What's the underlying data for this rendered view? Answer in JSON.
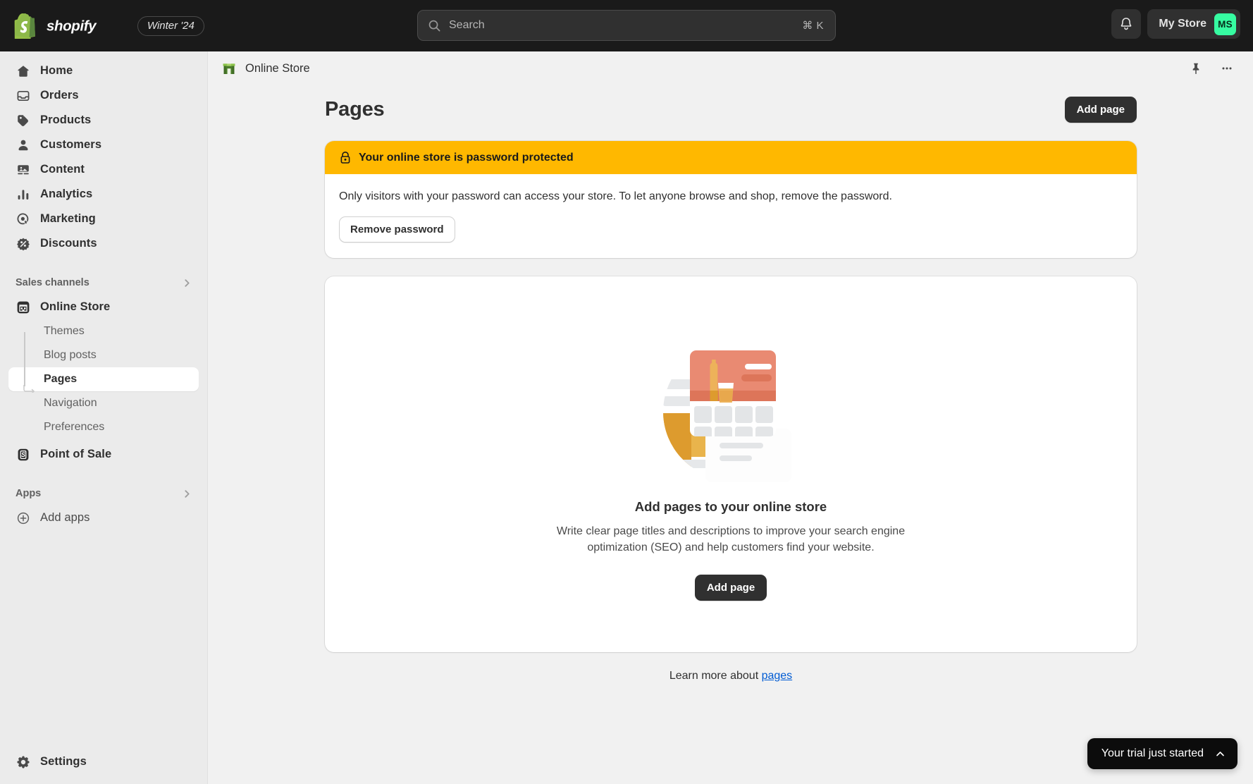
{
  "topbar": {
    "brand_name": "shopify",
    "version_badge": "Winter '24",
    "search": {
      "placeholder": "Search",
      "shortcut": "⌘ K"
    },
    "notifications_icon": "bell-icon",
    "store_name": "My Store",
    "avatar_initials": "MS",
    "avatar_color": "#36fba1"
  },
  "sidebar": {
    "items": [
      {
        "label": "Home",
        "icon": "home-icon"
      },
      {
        "label": "Orders",
        "icon": "orders-icon"
      },
      {
        "label": "Products",
        "icon": "products-tag-icon"
      },
      {
        "label": "Customers",
        "icon": "customers-person-icon"
      },
      {
        "label": "Content",
        "icon": "content-image-icon"
      },
      {
        "label": "Analytics",
        "icon": "analytics-bars-icon"
      },
      {
        "label": "Marketing",
        "icon": "marketing-target-icon"
      },
      {
        "label": "Discounts",
        "icon": "discounts-percent-icon"
      }
    ],
    "sales_channels": {
      "label": "Sales channels",
      "online_store": {
        "label": "Online Store",
        "icon": "storefront-icon"
      },
      "sub_items": [
        {
          "label": "Themes",
          "active": false
        },
        {
          "label": "Blog posts",
          "active": false
        },
        {
          "label": "Pages",
          "active": true
        },
        {
          "label": "Navigation",
          "active": false
        },
        {
          "label": "Preferences",
          "active": false
        }
      ],
      "point_of_sale": {
        "label": "Point of Sale",
        "icon": "pos-icon"
      }
    },
    "apps": {
      "label": "Apps",
      "add_apps": {
        "label": "Add apps",
        "icon": "plus-circle-icon"
      }
    },
    "settings": {
      "label": "Settings",
      "icon": "gear-icon"
    }
  },
  "page_topbar": {
    "breadcrumb_label": "Online Store",
    "breadcrumb_icon": "online-store-green-icon",
    "pin_icon": "pin-icon",
    "more_icon": "ellipsis-icon"
  },
  "page": {
    "title": "Pages",
    "add_page_label": "Add page"
  },
  "password_banner": {
    "icon": "lock-icon",
    "heading": "Your online store is password protected",
    "body": "Only visitors with your password can access your store. To let anyone browse and shop, remove the password.",
    "action_label": "Remove password",
    "accent_color": "#ffb800"
  },
  "empty_state": {
    "illustration": "pages-illustration",
    "title": "Add pages to your online store",
    "description": "Write clear page titles and descriptions to improve your search engine optimization (SEO) and help customers find your website.",
    "action_label": "Add page"
  },
  "learn_more": {
    "prefix": "Learn more about ",
    "link_label": "pages",
    "link_color": "#005bd3"
  },
  "trial_banner": {
    "label": "Your trial just started",
    "chevron_icon": "chevron-up-icon"
  }
}
